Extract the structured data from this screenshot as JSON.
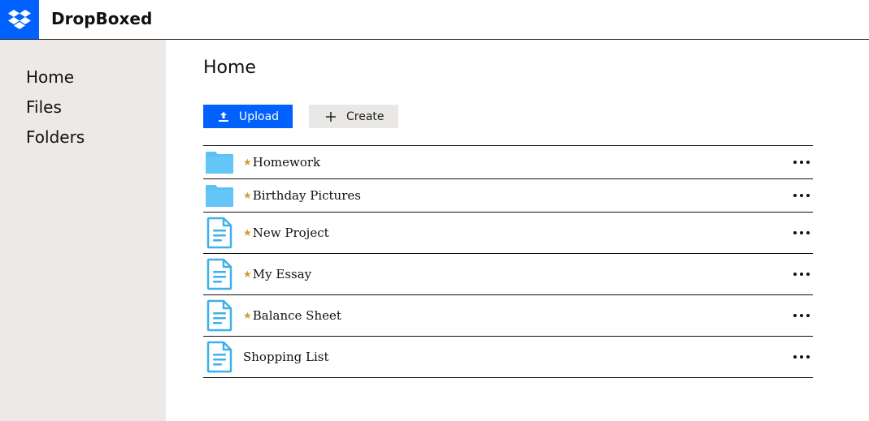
{
  "app": {
    "title": "DropBoxed",
    "brand_color": "#0061fe",
    "logo_icon": "dropbox-logo-icon"
  },
  "sidebar": {
    "items": [
      {
        "label": "Home"
      },
      {
        "label": "Files"
      },
      {
        "label": "Folders"
      }
    ]
  },
  "main": {
    "title": "Home",
    "toolbar": {
      "upload_label": "Upload",
      "upload_icon": "upload-icon",
      "create_label": "Create",
      "create_icon": "plus-icon"
    },
    "files": [
      {
        "type": "folder",
        "name": "Homework",
        "starred": true,
        "icon": "folder-icon",
        "more_icon": "more-options-icon"
      },
      {
        "type": "folder",
        "name": "Birthday Pictures",
        "starred": true,
        "icon": "folder-icon",
        "more_icon": "more-options-icon"
      },
      {
        "type": "document",
        "name": "New Project",
        "starred": true,
        "icon": "document-icon",
        "more_icon": "more-options-icon"
      },
      {
        "type": "document",
        "name": "My Essay",
        "starred": true,
        "icon": "document-icon",
        "more_icon": "more-options-icon"
      },
      {
        "type": "document",
        "name": "Balance Sheet",
        "starred": true,
        "icon": "document-icon",
        "more_icon": "more-options-icon"
      },
      {
        "type": "document",
        "name": "Shopping List",
        "starred": false,
        "icon": "document-icon",
        "more_icon": "more-options-icon"
      }
    ],
    "colors": {
      "folder": "#5bc1f5",
      "document": "#3fb0ea",
      "star": "#d59a2f"
    }
  }
}
